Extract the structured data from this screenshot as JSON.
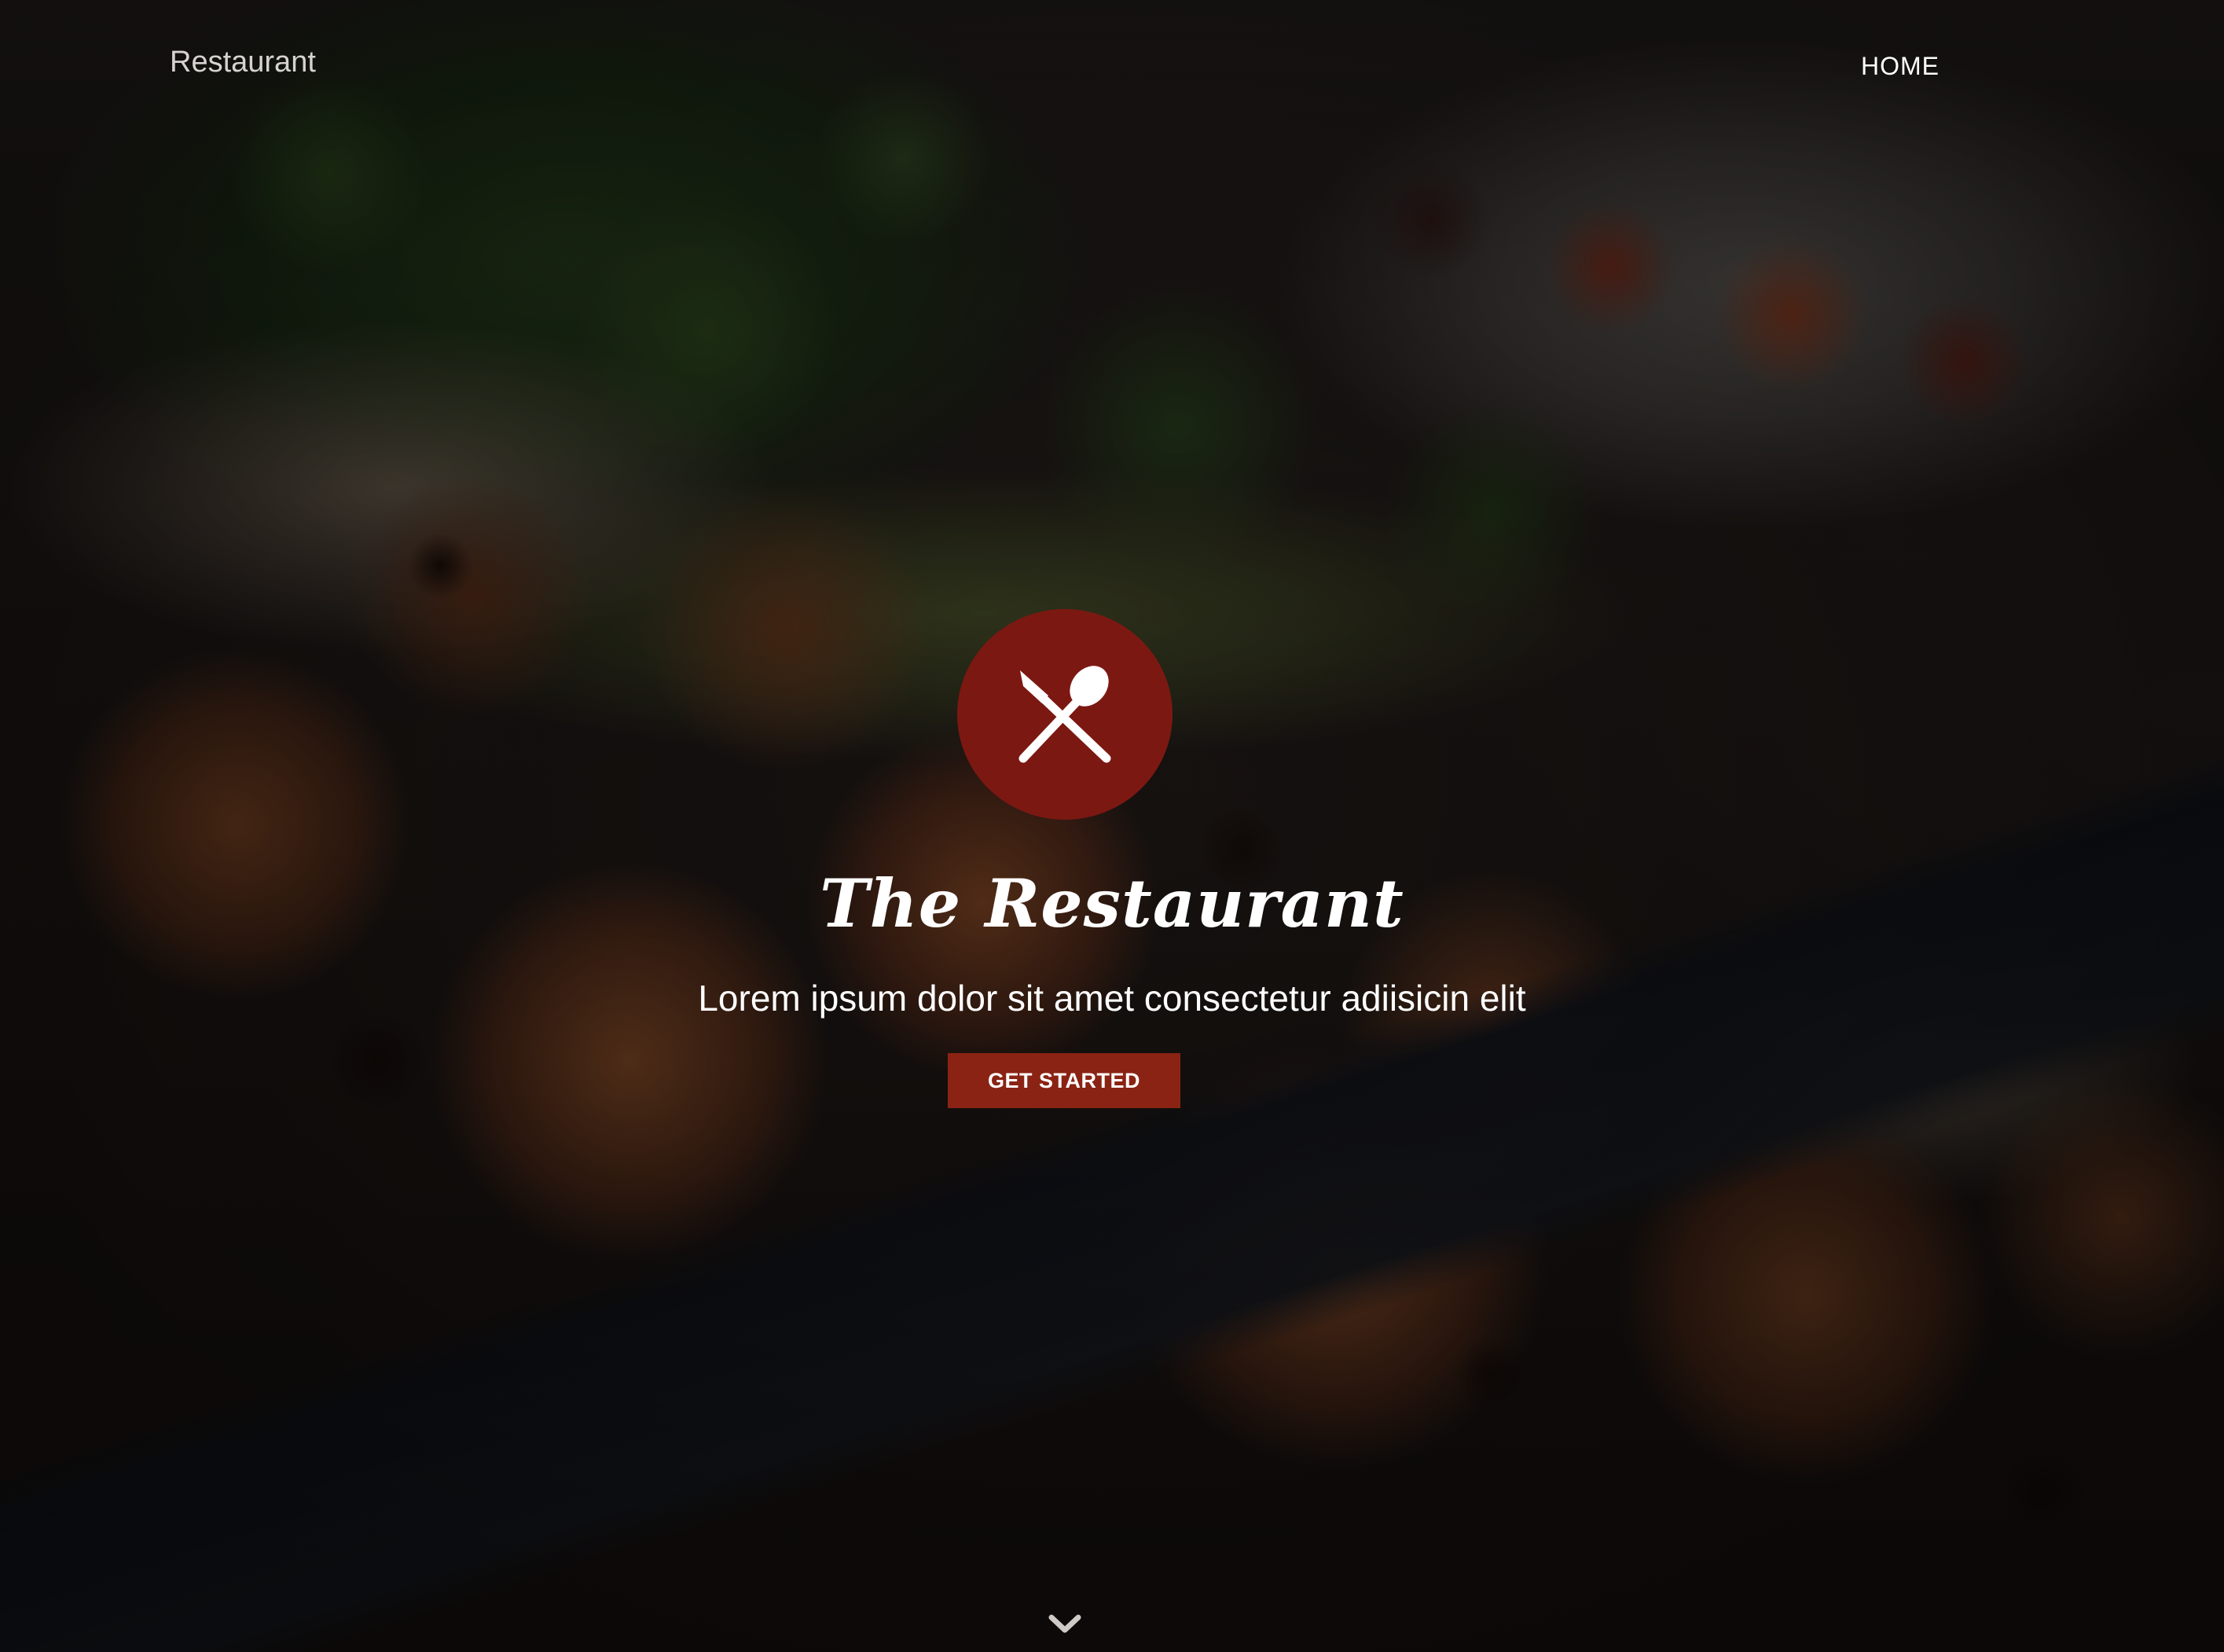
{
  "nav": {
    "brand": "Restaurant",
    "home_label": "HOME"
  },
  "hero": {
    "title": "The Restaurant",
    "tagline": "Lorem ipsum dolor sit amet consectetur adiisicin elit",
    "cta_label": "GET STARTED",
    "logo_icon": "utensils-icon",
    "scroll_icon": "chevron-down-icon"
  },
  "colors": {
    "accent": "#7c1812",
    "button": "#8a2313",
    "text": "#ffffff",
    "brand_text": "#d6d2cf"
  }
}
